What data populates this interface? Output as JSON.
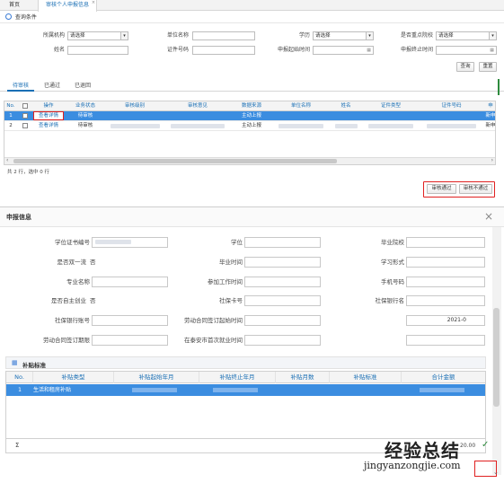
{
  "tabs": [
    {
      "label": "首页",
      "active": false
    },
    {
      "label": "审核个人申报信息",
      "active": true,
      "close": "×"
    }
  ],
  "query": {
    "title": "查询条件",
    "fields": {
      "affiliation_label": "所属机构",
      "affiliation_value": "请选择",
      "unit_label": "单位名称",
      "education_label": "学历",
      "education_value": "请选择",
      "key_school_label": "是否重点院校",
      "key_school_value": "请选择",
      "name_label": "姓名",
      "id_label": "证件号码",
      "apply_start_label": "申报起始时间",
      "apply_end_label": "申报终止时间"
    },
    "search_btn": "查询",
    "reset_btn": "重置"
  },
  "subtabs": [
    "待审核",
    "已通过",
    "已退回"
  ],
  "grid": {
    "headers": [
      "No.",
      "",
      "操作",
      "业务状态",
      "审核级别",
      "审核意见",
      "数据来源",
      "单位名称",
      "姓名",
      "证件类型",
      "证件号码",
      "申"
    ],
    "rows": [
      {
        "no": "1",
        "action": "查看详情",
        "status": "待审核",
        "source": "主动上报",
        "last": "新申"
      },
      {
        "no": "2",
        "action": "查看详情",
        "status": "待审核",
        "source": "主动上报",
        "last": "新申"
      }
    ],
    "footer": "共 2 行，选中 0 行"
  },
  "actions": {
    "approve": "审核通过",
    "reject": "审核不通过"
  },
  "dialog": {
    "title": "申报信息",
    "close": "×",
    "fields": {
      "degree_cert_label": "学位证书编号",
      "degree_label": "学位",
      "school_label": "毕业院校",
      "double_first_label": "是否双一流",
      "double_first_value": "否",
      "grad_time_label": "毕业时间",
      "study_form_label": "学习形式",
      "major_label": "专业名称",
      "work_time_label": "参加工作时间",
      "phone_label": "手机号码",
      "self_employed_label": "是否自主创业",
      "self_employed_value": "否",
      "social_card_label": "社保卡号",
      "bank_label": "社保银行名",
      "bank_account_label": "社保银行账号",
      "contract_start_label": "劳动合同签订起始时间",
      "contract_start_value": "2021-0",
      "contract_end_label": "劳动合同签订期限",
      "first_job_label": "在泰安市首次就业时间"
    },
    "subsidy": {
      "title": "补贴标准",
      "headers": [
        "No.",
        "补贴类型",
        "补贴起始年月",
        "补贴终止年月",
        "补贴月数",
        "补贴标准",
        "合计金额"
      ],
      "rows": [
        {
          "no": "1",
          "type": "生活和租房补贴"
        }
      ],
      "sum_label": "Σ",
      "sum_value": "20.00"
    }
  },
  "watermark": {
    "brand": "经验总结",
    "url": "jingyanzongjie.com"
  }
}
